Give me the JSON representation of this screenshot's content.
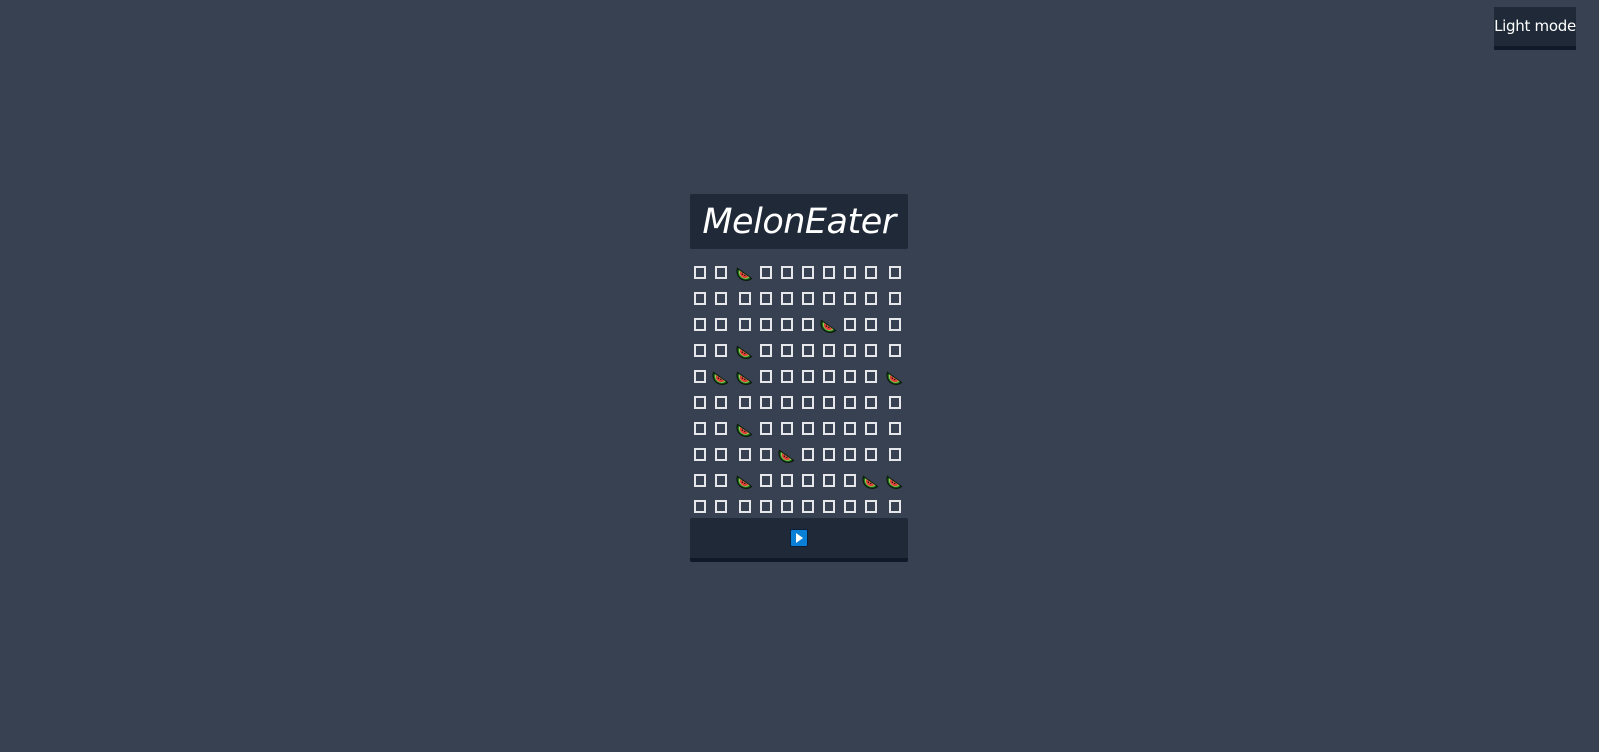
{
  "header": {
    "theme_toggle_label": "Light mode",
    "title": "MelonEater"
  },
  "board": {
    "rows": 10,
    "cols": 10,
    "icons": {
      "melon": "watermelon-icon",
      "empty": "empty-square-icon"
    },
    "cells": [
      [
        "empty",
        "empty",
        "melon",
        "empty",
        "empty",
        "empty",
        "empty",
        "empty",
        "empty",
        "empty"
      ],
      [
        "empty",
        "empty",
        "empty",
        "empty",
        "empty",
        "empty",
        "empty",
        "empty",
        "empty",
        "empty"
      ],
      [
        "empty",
        "empty",
        "empty",
        "empty",
        "empty",
        "empty",
        "melon",
        "empty",
        "empty",
        "empty"
      ],
      [
        "empty",
        "empty",
        "melon",
        "empty",
        "empty",
        "empty",
        "empty",
        "empty",
        "empty",
        "empty"
      ],
      [
        "empty",
        "melon",
        "melon",
        "empty",
        "empty",
        "empty",
        "empty",
        "empty",
        "empty",
        "melon"
      ],
      [
        "empty",
        "empty",
        "empty",
        "empty",
        "empty",
        "empty",
        "empty",
        "empty",
        "empty",
        "empty"
      ],
      [
        "empty",
        "empty",
        "melon",
        "empty",
        "empty",
        "empty",
        "empty",
        "empty",
        "empty",
        "empty"
      ],
      [
        "empty",
        "empty",
        "empty",
        "empty",
        "melon",
        "empty",
        "empty",
        "empty",
        "empty",
        "empty"
      ],
      [
        "empty",
        "empty",
        "melon",
        "empty",
        "empty",
        "empty",
        "empty",
        "empty",
        "melon",
        "melon"
      ],
      [
        "empty",
        "empty",
        "empty",
        "empty",
        "empty",
        "empty",
        "empty",
        "empty",
        "empty",
        "empty"
      ]
    ]
  },
  "controls": {
    "play_icon": "play-icon"
  },
  "colors": {
    "background": "#374151",
    "panel": "#1f2937",
    "panel_border": "#111827",
    "play_button": "#0a7fd6"
  }
}
